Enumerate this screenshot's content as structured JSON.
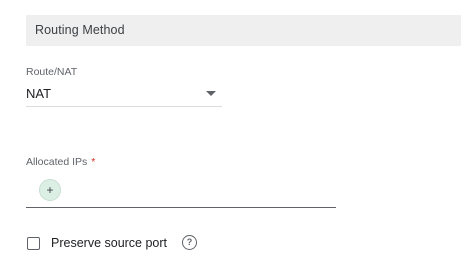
{
  "section": {
    "title": "Routing Method"
  },
  "route_nat": {
    "label": "Route/NAT",
    "value": "NAT"
  },
  "allocated_ips": {
    "label": "Allocated IPs",
    "required_mark": "*",
    "add_symbol": "+"
  },
  "preserve_source_port": {
    "label": "Preserve source port",
    "checked": false,
    "help_symbol": "?"
  },
  "icons": {
    "dropdown": "dropdown-arrow-icon",
    "add": "plus-icon",
    "help": "help-icon"
  },
  "colors": {
    "header_bg": "#efefef",
    "required": "#d93025",
    "add_button_bg": "#dcefe4"
  }
}
